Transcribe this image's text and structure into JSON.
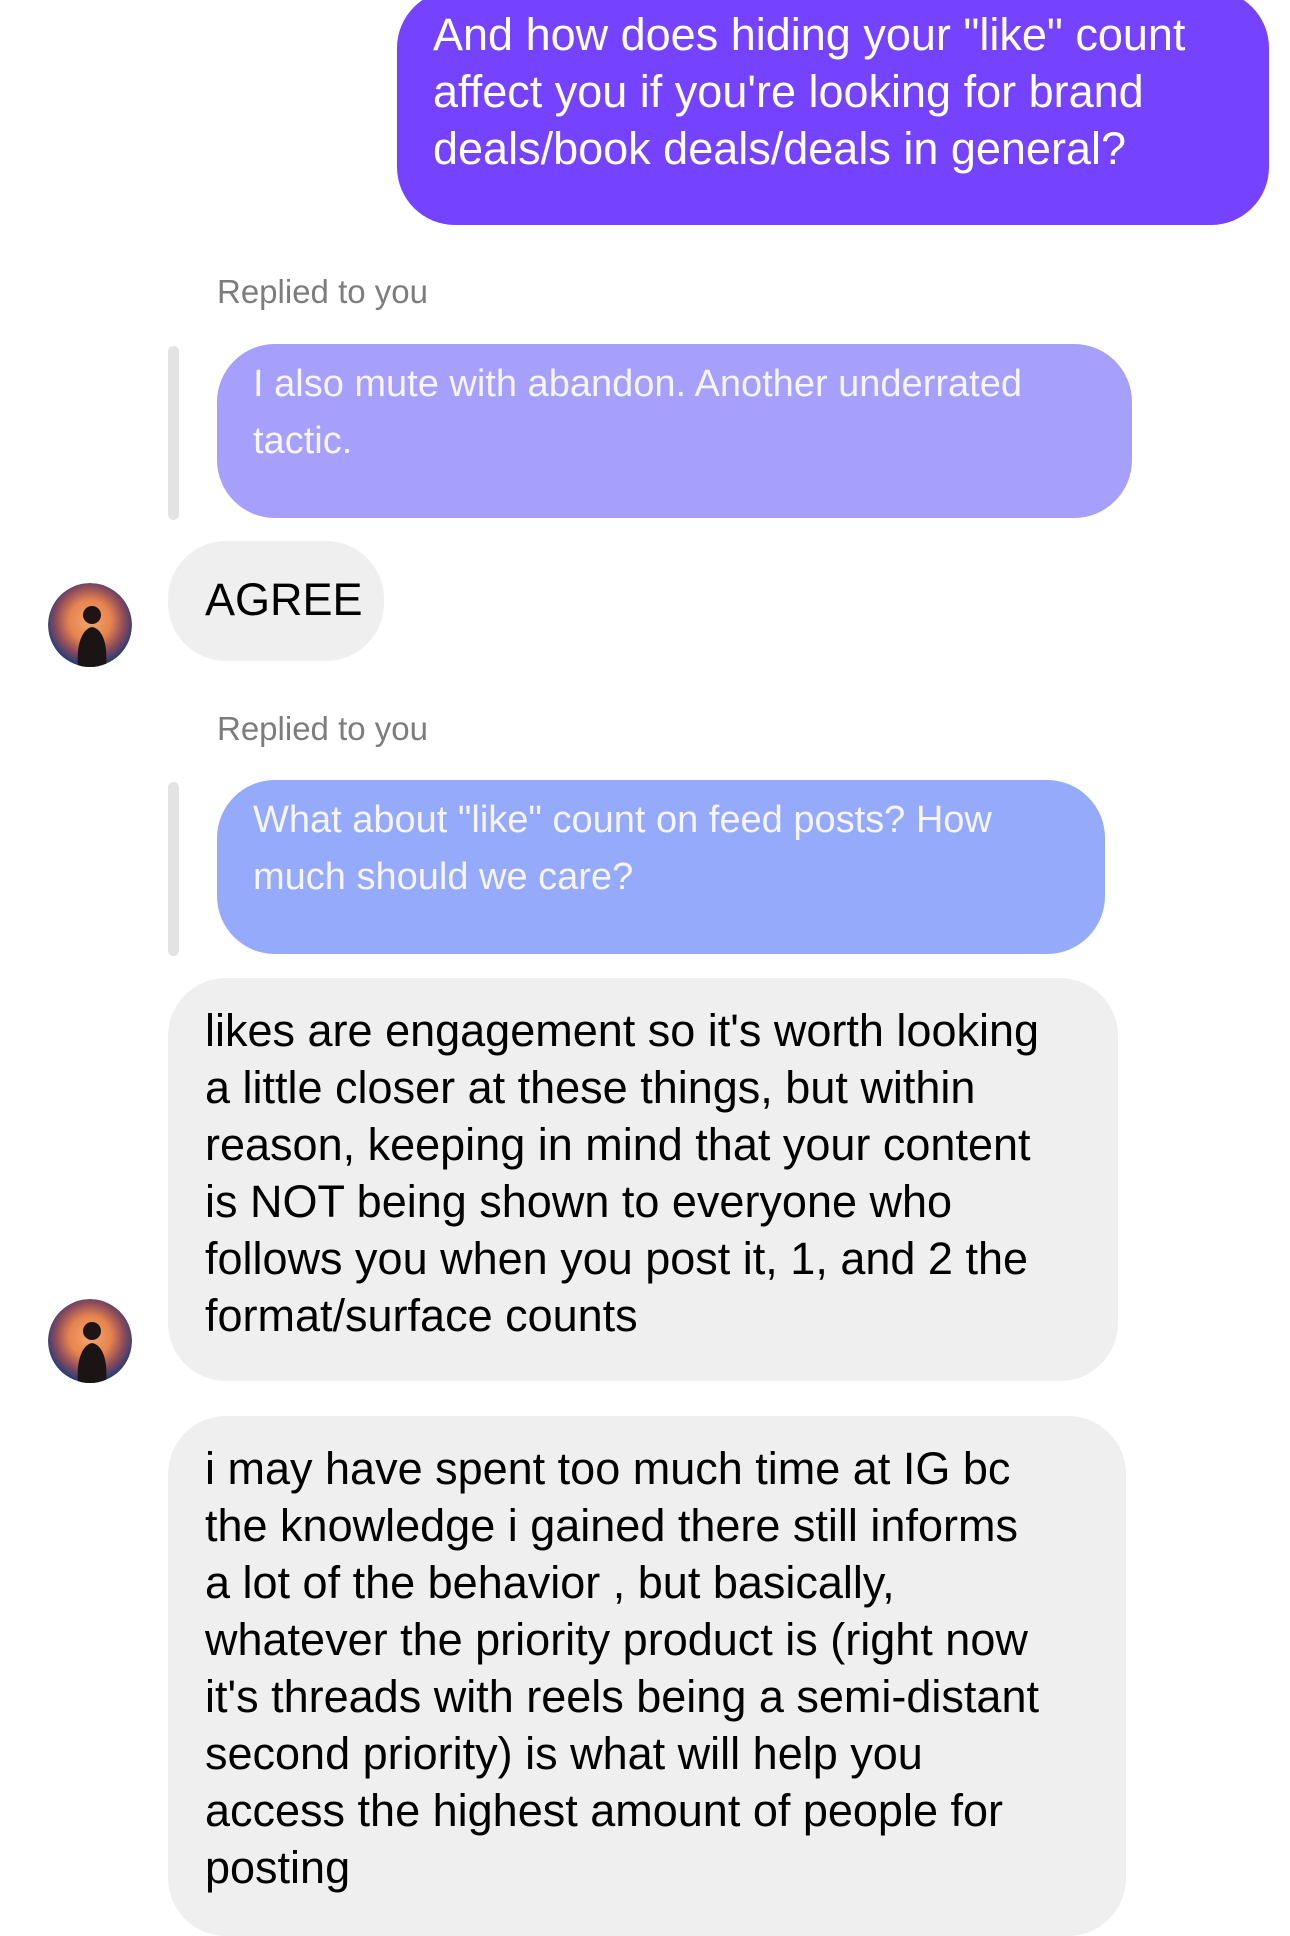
{
  "messages": {
    "sent": {
      "text": "And how does hiding your \"like\" count\naffect you if you're looking for brand\ndeals/book deals/deals in general?"
    },
    "reply1": {
      "caption": "Replied to you",
      "quoted_text": "I also mute with abandon. Another underrated\ntactic.",
      "text": "AGREE"
    },
    "reply2": {
      "caption": "Replied to you",
      "quoted_text": "What about \"like\" count on feed posts? How\nmuch should we care?",
      "text": "likes are engagement so it's worth looking\na little closer at these things, but within\nreason, keeping in mind that your content\nis NOT being shown to everyone who\nfollows you when you post it, 1, and 2 the\nformat/surface counts"
    },
    "followup": {
      "text": "i may have spent too much time at IG bc\nthe knowledge i gained there still informs\na lot of the behavior , but basically,\nwhatever the priority product is (right now\nit's threads with reels being a semi-distant\nsecond priority) is what will help you\naccess the highest amount of people for\nposting"
    }
  },
  "colors": {
    "sent_bubble": "#7542ff",
    "quoted_bubble_1": "#a69ffb",
    "quoted_bubble_2": "#96aafb",
    "received_bubble": "#efefef",
    "caption_text": "#7d7d7d"
  },
  "icons": {
    "avatar": "user-avatar-icon"
  }
}
